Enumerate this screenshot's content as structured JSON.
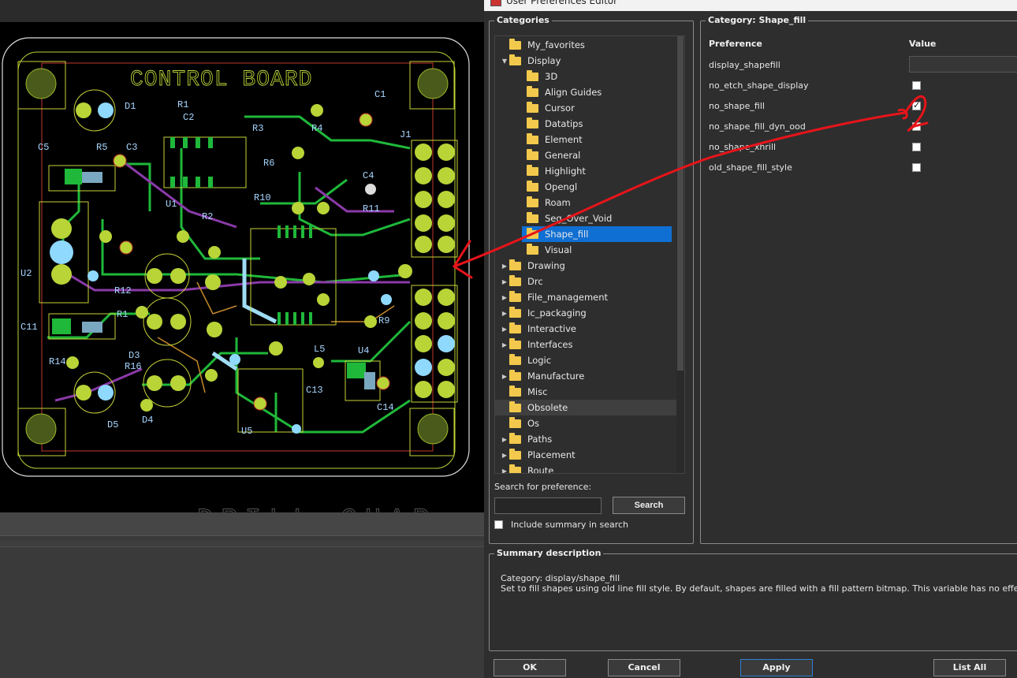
{
  "dialog": {
    "title": "User Preferences Editor"
  },
  "pcb": {
    "board_title": "CONTROL BOARD",
    "bottom_text": "DRILL CHAR",
    "labels": [
      "D1",
      "R1",
      "C1",
      "C2",
      "R3",
      "R4",
      "J1",
      "C5",
      "R5",
      "C3",
      "R6",
      "C4",
      "R2",
      "R10",
      "R11",
      "U1",
      "U2",
      "C11",
      "R12",
      "R1",
      "D3",
      "R16",
      "R14",
      "L5",
      "U4",
      "C13",
      "C14",
      "U5",
      "D5",
      "D4",
      "R9"
    ]
  },
  "categories": {
    "title": "Categories",
    "items": [
      {
        "label": "My_favorites",
        "level": 1,
        "arrow": ""
      },
      {
        "label": "Display",
        "level": 1,
        "arrow": "expanded"
      },
      {
        "label": "3D",
        "level": 2,
        "arrow": ""
      },
      {
        "label": "Align Guides",
        "level": 2,
        "arrow": ""
      },
      {
        "label": "Cursor",
        "level": 2,
        "arrow": ""
      },
      {
        "label": "Datatips",
        "level": 2,
        "arrow": ""
      },
      {
        "label": "Element",
        "level": 2,
        "arrow": ""
      },
      {
        "label": "General",
        "level": 2,
        "arrow": ""
      },
      {
        "label": "Highlight",
        "level": 2,
        "arrow": ""
      },
      {
        "label": "Opengl",
        "level": 2,
        "arrow": ""
      },
      {
        "label": "Roam",
        "level": 2,
        "arrow": ""
      },
      {
        "label": "Seg_Over_Void",
        "level": 2,
        "arrow": ""
      },
      {
        "label": "Shape_fill",
        "level": 2,
        "arrow": "",
        "selected": true
      },
      {
        "label": "Visual",
        "level": 2,
        "arrow": ""
      },
      {
        "label": "Drawing",
        "level": 1,
        "arrow": "collapsed"
      },
      {
        "label": "Drc",
        "level": 1,
        "arrow": "collapsed"
      },
      {
        "label": "File_management",
        "level": 1,
        "arrow": "collapsed"
      },
      {
        "label": "Ic_packaging",
        "level": 1,
        "arrow": "collapsed"
      },
      {
        "label": "Interactive",
        "level": 1,
        "arrow": "collapsed"
      },
      {
        "label": "Interfaces",
        "level": 1,
        "arrow": "collapsed"
      },
      {
        "label": "Logic",
        "level": 1,
        "arrow": ""
      },
      {
        "label": "Manufacture",
        "level": 1,
        "arrow": "collapsed"
      },
      {
        "label": "Misc",
        "level": 1,
        "arrow": ""
      },
      {
        "label": "Obsolete",
        "level": 1,
        "arrow": "",
        "hover": true
      },
      {
        "label": "Os",
        "level": 1,
        "arrow": ""
      },
      {
        "label": "Paths",
        "level": 1,
        "arrow": "collapsed"
      },
      {
        "label": "Placement",
        "level": 1,
        "arrow": "collapsed"
      },
      {
        "label": "Route",
        "level": 1,
        "arrow": "collapsed"
      }
    ],
    "search_label": "Search for preference:",
    "search_value": "",
    "search_button": "Search",
    "include_summary_label": "Include summary in search",
    "include_summary_checked": false
  },
  "category_panel": {
    "title": "Category:  Shape_fill",
    "col_preference": "Preference",
    "col_value": "Value",
    "prefs": [
      {
        "name": "display_shapefill",
        "type": "text",
        "value": ""
      },
      {
        "name": "no_etch_shape_display",
        "type": "checkbox",
        "checked": false
      },
      {
        "name": "no_shape_fill",
        "type": "checkbox",
        "checked": true
      },
      {
        "name": "no_shape_fill_dyn_ood",
        "type": "checkbox",
        "checked": false
      },
      {
        "name": "no_shape_xhrill",
        "type": "checkbox",
        "checked": false
      },
      {
        "name": "old_shape_fill_style",
        "type": "checkbox",
        "checked": false
      }
    ]
  },
  "summary": {
    "title": "Summary description",
    "category_line": "Category: display/shape_fill",
    "description": "Set to fill shapes using old line fill style. By default, shapes are filled with a fill pattern bitmap. This variable has no effect in Ope"
  },
  "buttons": {
    "ok": "OK",
    "cancel": "Cancel",
    "apply": "Apply",
    "list_all": "List All"
  },
  "colors": {
    "accent": "#0f6fd3",
    "annotation": "#e8141a",
    "trace_green": "#1fb83a",
    "pad_yellow": "#b8d437",
    "pad_cyan": "#8fd9ff"
  }
}
